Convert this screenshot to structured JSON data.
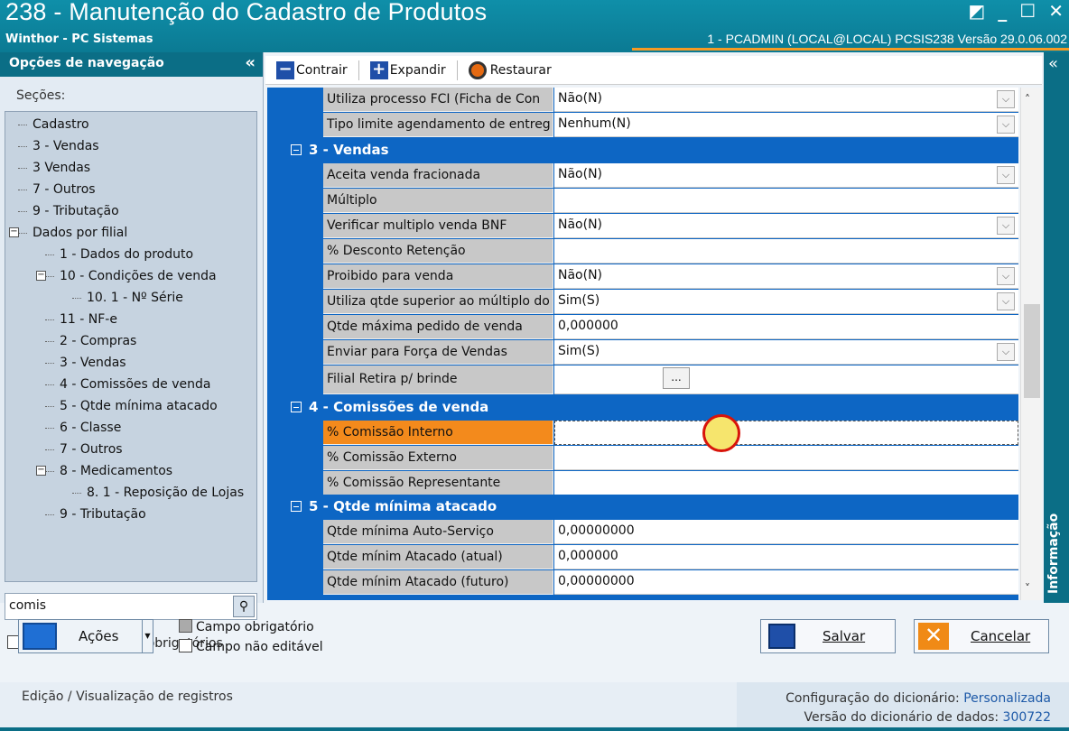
{
  "window": {
    "title": "238 - Manutenção do Cadastro de Produtos",
    "subtitle": "Winthor - PC Sistemas",
    "info": "1 - PCADMIN (LOCAL@LOCAL)   PCSIS238  Versão  29.0.06.002",
    "buttons": {
      "restore": "◩",
      "minimize": "_",
      "maximize": "☐",
      "close": "✕"
    }
  },
  "nav": {
    "title": "Opções de navegação",
    "collapse": "«",
    "secoes_label": "Seções:",
    "tree": [
      {
        "label": "Cadastro"
      },
      {
        "label": "3 - Vendas"
      },
      {
        "label": "3 Vendas"
      },
      {
        "label": "7 - Outros"
      },
      {
        "label": "9 - Tributação"
      },
      {
        "label": "Dados por filial"
      },
      {
        "label": "1 - Dados do produto"
      },
      {
        "label": "10 - Condições de venda"
      },
      {
        "label": "10. 1 - Nº Série"
      },
      {
        "label": "11 - NF-e"
      },
      {
        "label": "2 - Compras"
      },
      {
        "label": "3 - Vendas"
      },
      {
        "label": "4 - Comissões de venda"
      },
      {
        "label": "5 - Qtde mínima atacado"
      },
      {
        "label": "6 - Classe"
      },
      {
        "label": "7 - Outros"
      },
      {
        "label": "8 - Medicamentos"
      },
      {
        "label": "8. 1 -  Reposição de Lojas"
      },
      {
        "label": "9 - Tributação"
      }
    ],
    "search_value": "comis",
    "only_required_label": "Apenas os campos obrigatórios"
  },
  "toolbar": {
    "contrair": "Contrair",
    "expandir": "Expandir",
    "restaurar": "Restaurar"
  },
  "grid": {
    "rows": [
      {
        "label": "Utiliza processo FCI (Ficha de Con",
        "value": "Não(N)"
      },
      {
        "label": "Tipo limite agendamento de entreg",
        "value": "Nenhum(N)"
      },
      {
        "section": "3 - Vendas"
      },
      {
        "label": "Aceita venda fracionada",
        "value": "Não(N)"
      },
      {
        "label": "Múltiplo",
        "value": ""
      },
      {
        "label": "Verificar multiplo venda BNF",
        "value": "Não(N)"
      },
      {
        "label": "% Desconto Retenção",
        "value": ""
      },
      {
        "label": "Proibido para venda",
        "value": "Não(N)"
      },
      {
        "label": "Utiliza qtde superior ao múltiplo do",
        "value": "Sim(S)"
      },
      {
        "label": "Qtde máxima pedido de venda",
        "value": "0,000000"
      },
      {
        "label": "Enviar para Força de Vendas",
        "value": "Sim(S)"
      },
      {
        "label": "Filial Retira p/ brinde",
        "value": "",
        "ellipsis": "..."
      },
      {
        "section": "4 - Comissões de venda"
      },
      {
        "label": "% Comissão Interno",
        "value": ""
      },
      {
        "label": "% Comissão Externo",
        "value": ""
      },
      {
        "label": "% Comissão Representante",
        "value": ""
      },
      {
        "section": "5 - Qtde mínima atacado"
      },
      {
        "label": "Qtde mínima Auto-Serviço",
        "value": "0,00000000"
      },
      {
        "label": "Qtde mínim Atacado (atual)",
        "value": "0,000000"
      },
      {
        "label": "Qtde mínim Atacado (futuro)",
        "value": "0,00000000"
      }
    ],
    "dropdown_glyph": "⌵"
  },
  "scroll": {
    "up": "˄",
    "down": "˅"
  },
  "info_panel": {
    "label": "Informação",
    "collapse": "«"
  },
  "actions": {
    "acoes_label": "Ações",
    "legend_required": "Campo obrigatório",
    "legend_noneditable": "Campo não editável",
    "save_label": "Salvar",
    "cancel_label": "Cancelar"
  },
  "status": {
    "left": "Edição / Visualização de registros",
    "dict_config_label": "Configuração do dicionário:",
    "dict_config_value": "Personalizada",
    "dict_version_label": "Versão do dicionário de dados:",
    "dict_version_value": "300722"
  }
}
